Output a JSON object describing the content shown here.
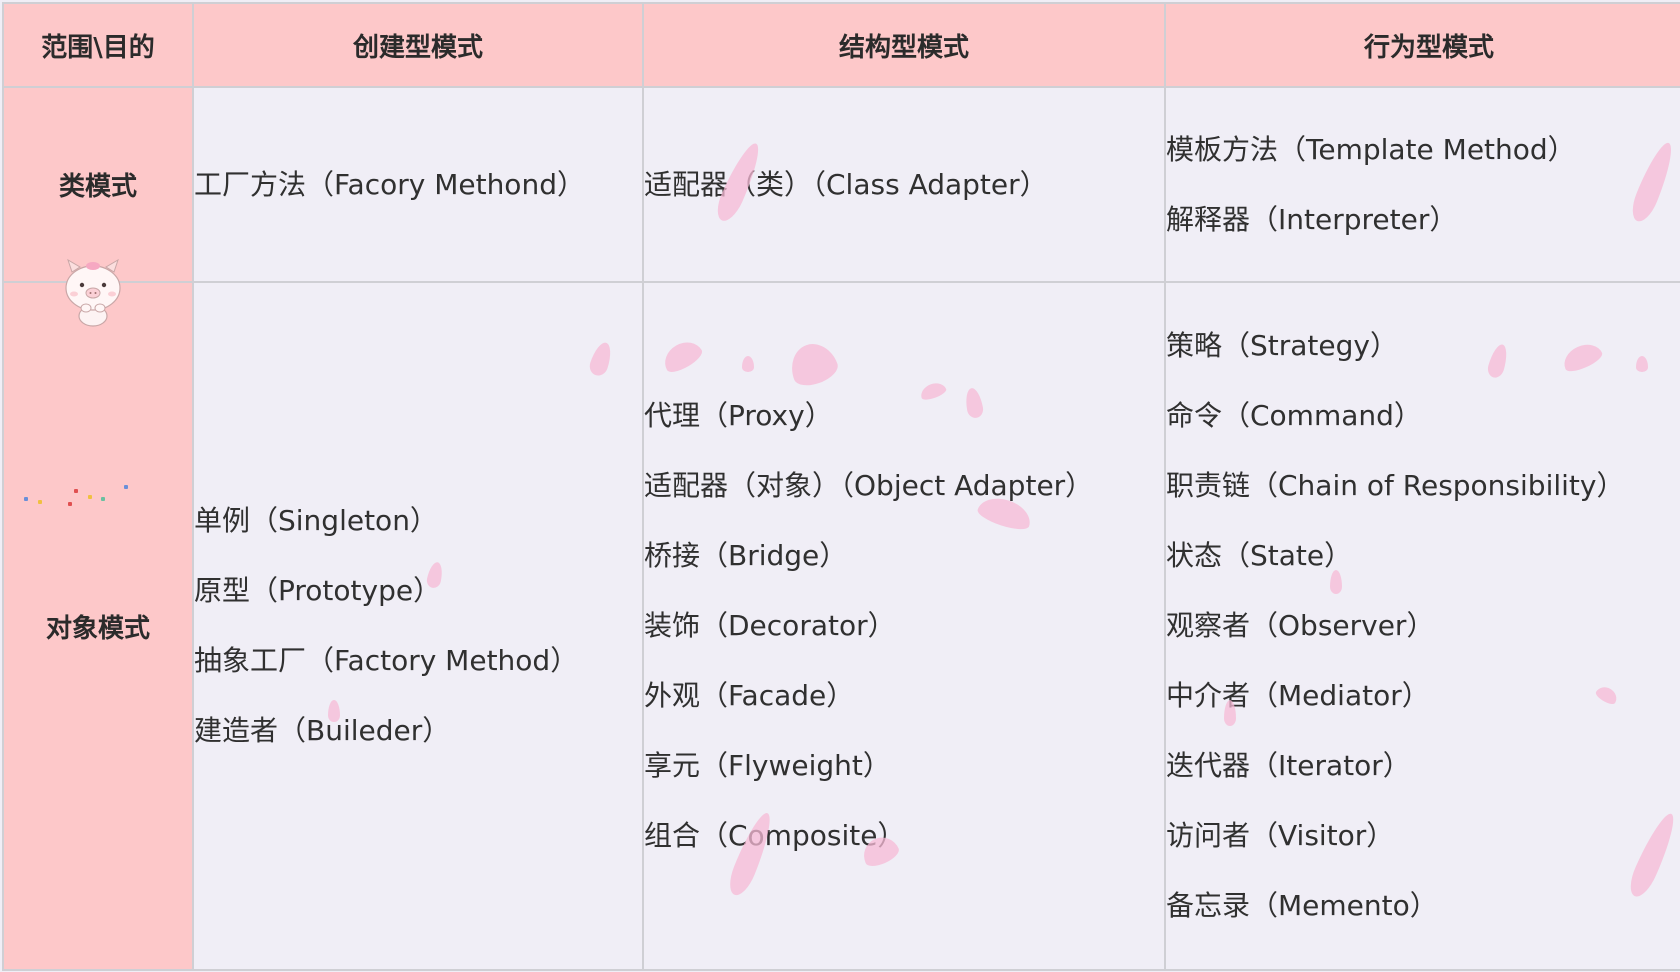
{
  "table": {
    "headers": [
      "范围\\目的",
      "创建型模式",
      "结构型模式",
      "行为型模式"
    ],
    "rows": [
      {
        "scope": "类模式",
        "creational": [
          "工厂方法（Facory Methond）"
        ],
        "structural": [
          "适配器（类）（Class Adapter）"
        ],
        "behavioral": [
          "模板方法（Template Method）",
          "解释器（Interpreter）"
        ]
      },
      {
        "scope": "对象模式",
        "creational": [
          "单例（Singleton）",
          "原型（Prototype）",
          "抽象工厂（Factory Method）",
          "建造者（Buileder）"
        ],
        "structural": [
          "代理（Proxy）",
          "适配器（对象）（Object Adapter）",
          "桥接（Bridge）",
          "装饰（Decorator）",
          "外观（Facade）",
          "享元（Flyweight）",
          "组合（Composite）"
        ],
        "behavioral": [
          "策略（Strategy）",
          "命令（Command）",
          "职责链（Chain of Responsibility）",
          "状态（State）",
          "观察者（Observer）",
          "中介者（Mediator）",
          "迭代器（Iterator）",
          "访问者（Visitor）",
          "备忘录（Memento）"
        ]
      }
    ]
  },
  "colors": {
    "header_bg": "#fdc8c9",
    "cell_bg": "#f0eef6",
    "border": "#cfcfd4",
    "petal": "#f7b9d6"
  },
  "decorations": {
    "mascot_icon": "pig-icon",
    "petal_icon": "sakura-petal-icon"
  }
}
